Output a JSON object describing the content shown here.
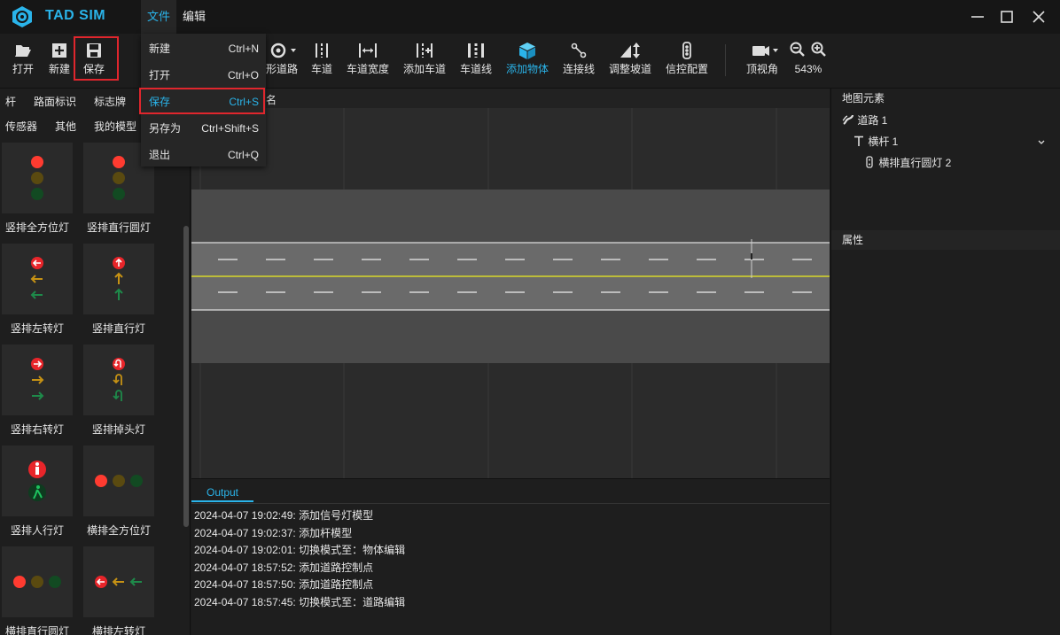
{
  "app": {
    "title": "TAD SIM",
    "menus": [
      "文件",
      "编辑"
    ],
    "brand_color": "#2ab4ea",
    "highlight_color": "#e0262d"
  },
  "toolbar": {
    "open": "打开",
    "new": "新建",
    "save": "保存",
    "shaped_road": "形道路",
    "lane": "车道",
    "lane_width": "车道宽度",
    "add_lane": "添加车道",
    "lane_line": "车道线",
    "add_object": "添加物体",
    "connect_line": "连接线",
    "adjust_slope": "调整坡道",
    "signal_config": "信控配置",
    "top_view": "顶视角",
    "zoom": "543%"
  },
  "file_menu": {
    "items": [
      {
        "label": "新建",
        "shortcut": "Ctrl+N"
      },
      {
        "label": "打开",
        "shortcut": "Ctrl+O"
      },
      {
        "label": "保存",
        "shortcut": "Ctrl+S"
      },
      {
        "label": "另存为",
        "shortcut": "Ctrl+Shift+S"
      },
      {
        "label": "退出",
        "shortcut": "Ctrl+Q"
      }
    ]
  },
  "left_panel": {
    "tabs_row1": [
      "杆",
      "路面标识",
      "标志牌"
    ],
    "tabs_row2": [
      "传感器",
      "其他",
      "我的模型"
    ],
    "models": [
      "竖排全方位灯",
      "竖排直行圆灯",
      "竖排左转灯",
      "竖排直行灯",
      "竖排右转灯",
      "竖排掉头灯",
      "竖排人行灯",
      "横排全方位灯",
      "横排直行圆灯",
      "横排左转灯"
    ]
  },
  "viewport": {
    "header_fragment": "名"
  },
  "output": {
    "tab": "Output",
    "lines": [
      "2024-04-07 19:02:49: 添加信号灯模型",
      "2024-04-07 19:02:37: 添加杆模型",
      "2024-04-07 19:02:01: 切换模式至：物体编辑",
      "2024-04-07 18:57:52: 添加道路控制点",
      "2024-04-07 18:57:50: 添加道路控制点",
      "2024-04-07 18:57:45: 切换模式至：道路编辑"
    ]
  },
  "right_panel": {
    "map_elements": "地图元素",
    "tree": [
      "道路 1",
      "横杆 1",
      "横排直行圆灯 2"
    ],
    "properties": "属性"
  },
  "icons": {
    "logo": "hexagon-wheel-icon",
    "open": "folder-open-icon",
    "new": "plus-box-icon",
    "save": "floppy-icon",
    "add_object": "cube-icon",
    "signal": "traffic-light-icon",
    "camera": "camera-icon",
    "zoom_out": "zoom-out-icon",
    "zoom_in": "zoom-in-icon"
  }
}
